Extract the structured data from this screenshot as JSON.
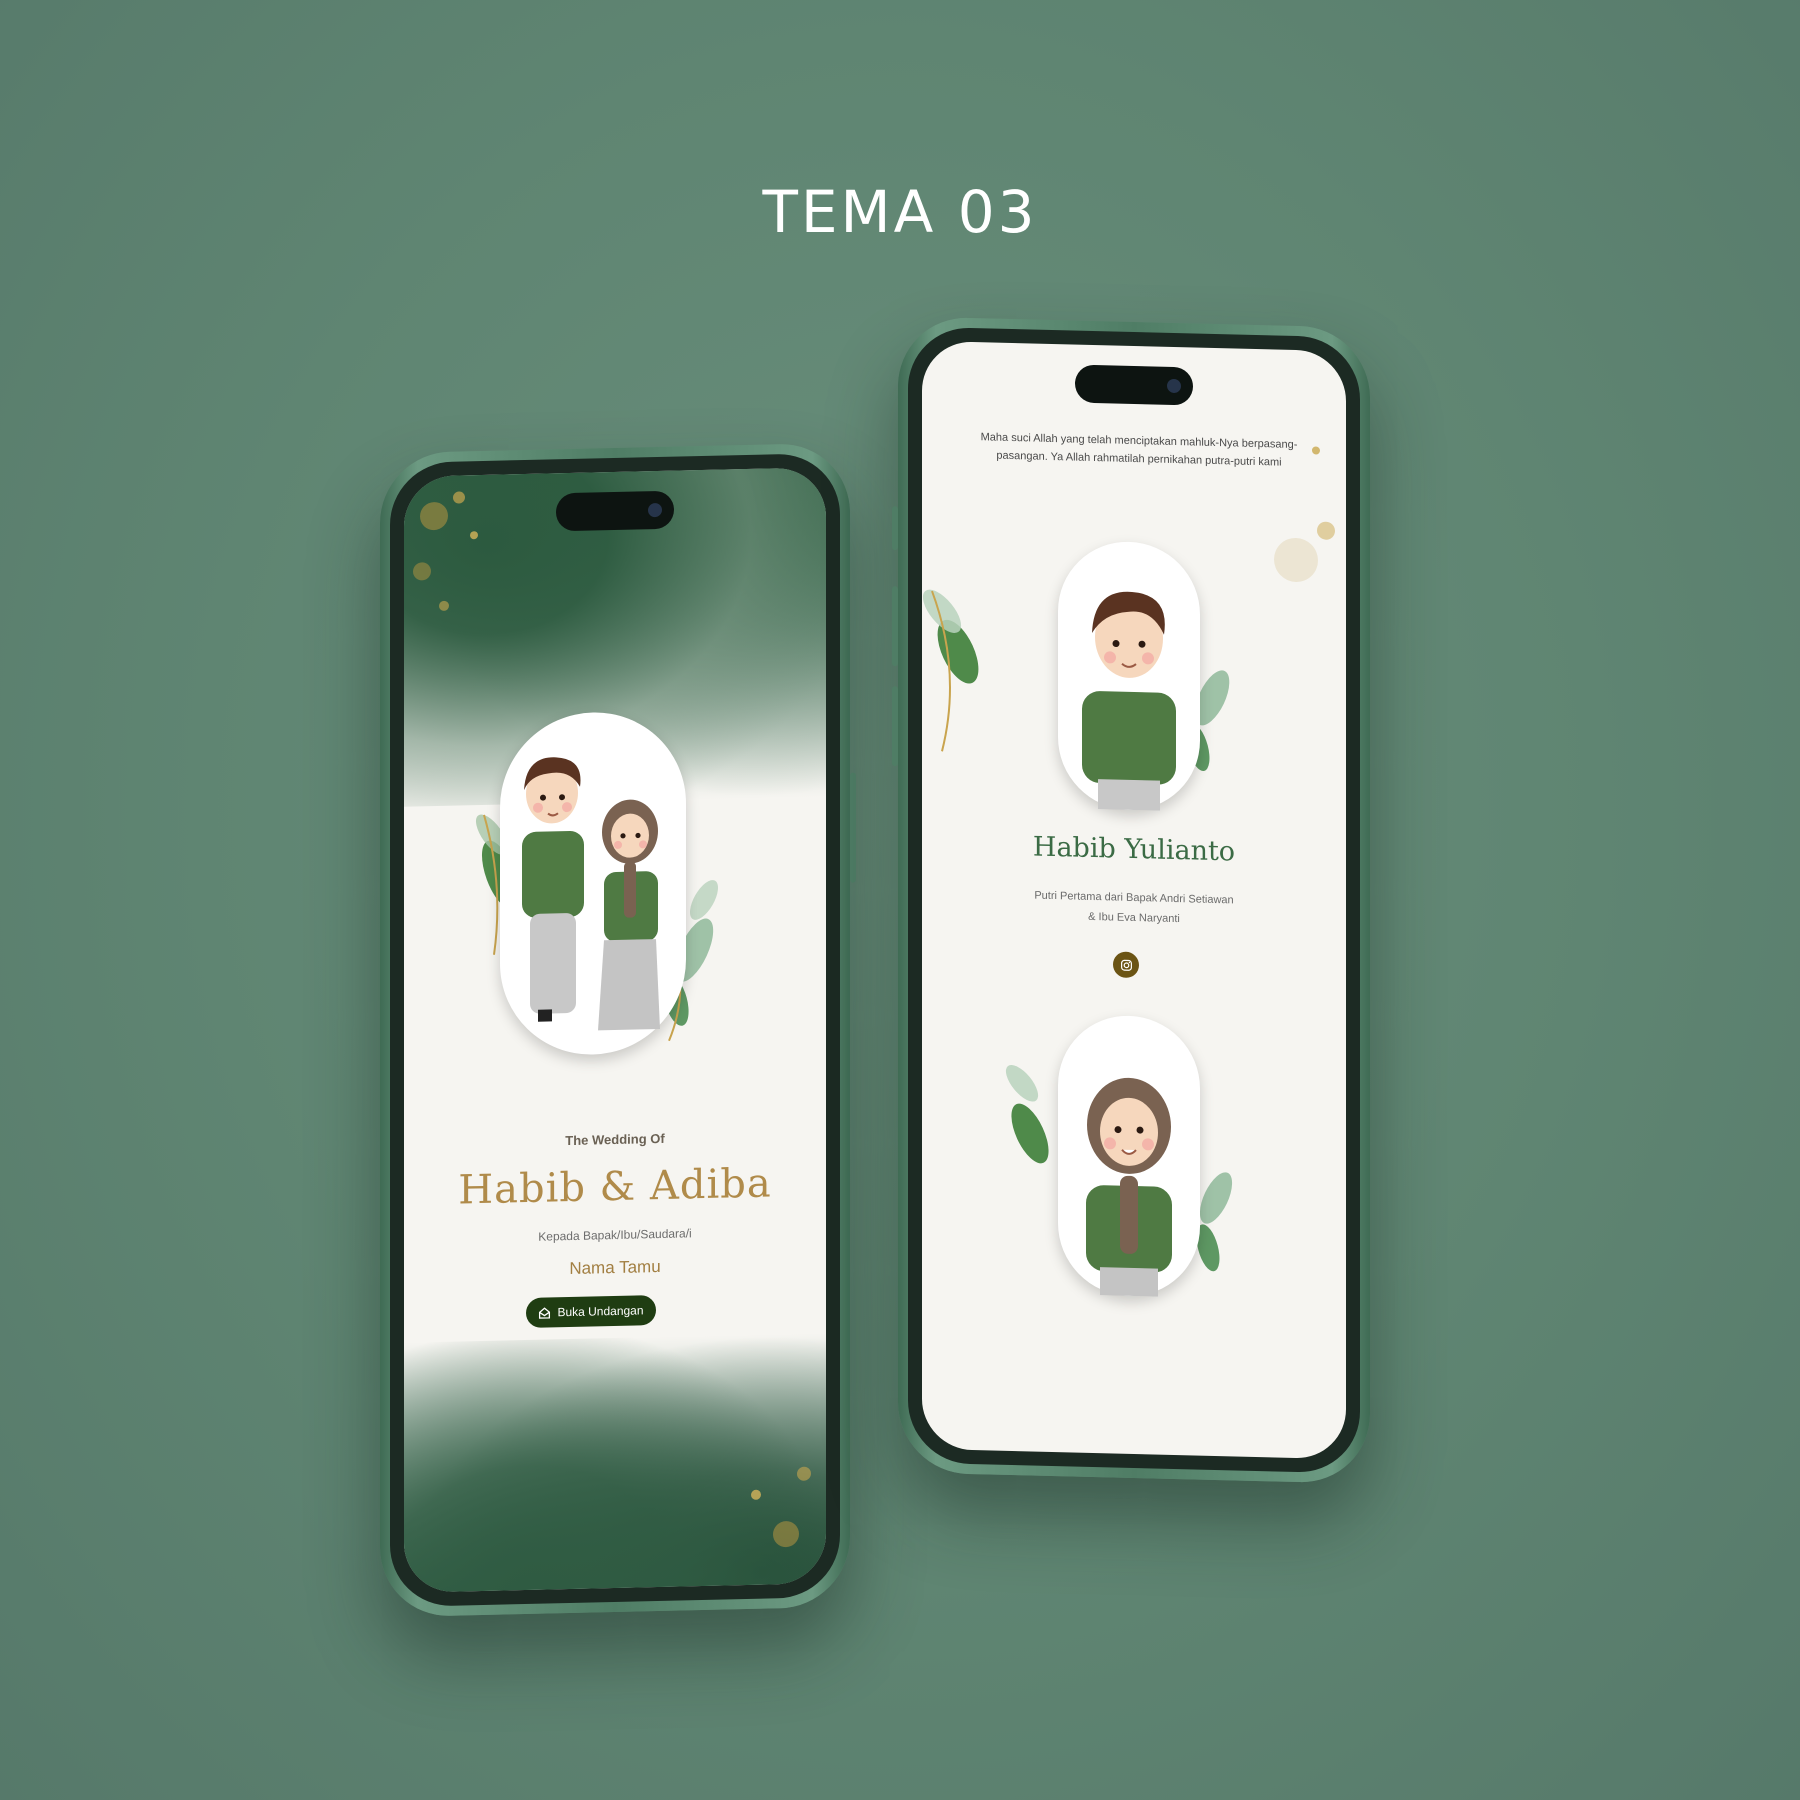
{
  "page": {
    "title": "TEMA 03"
  },
  "left_phone": {
    "wedding_of_label": "The Wedding Of",
    "couple_names": "Habib & Adiba",
    "addressee_label": "Kepada Bapak/Ibu/Saudara/i",
    "guest_name": "Nama Tamu",
    "open_button": {
      "label": "Buka Undangan",
      "icon": "envelope-open-icon"
    }
  },
  "right_phone": {
    "verse": "Maha suci Allah yang telah menciptakan mahluk-Nya berpasang-pasangan. Ya Allah rahmatilah pernikahan putra-putri kami",
    "groom": {
      "name": "Habib Yulianto",
      "parents_line1": "Putri Pertama dari Bapak Andri Setiawan",
      "parents_line2": "& Ibu Eva Naryanti",
      "social_icon": "instagram-icon"
    }
  },
  "colors": {
    "background": "#5f8572",
    "phone_frame": "#4f7d65",
    "accent_gold": "#b08b4a",
    "button_green": "#1f3d12",
    "name_green": "#3b6b45",
    "instagram_button": "#6b5414"
  }
}
